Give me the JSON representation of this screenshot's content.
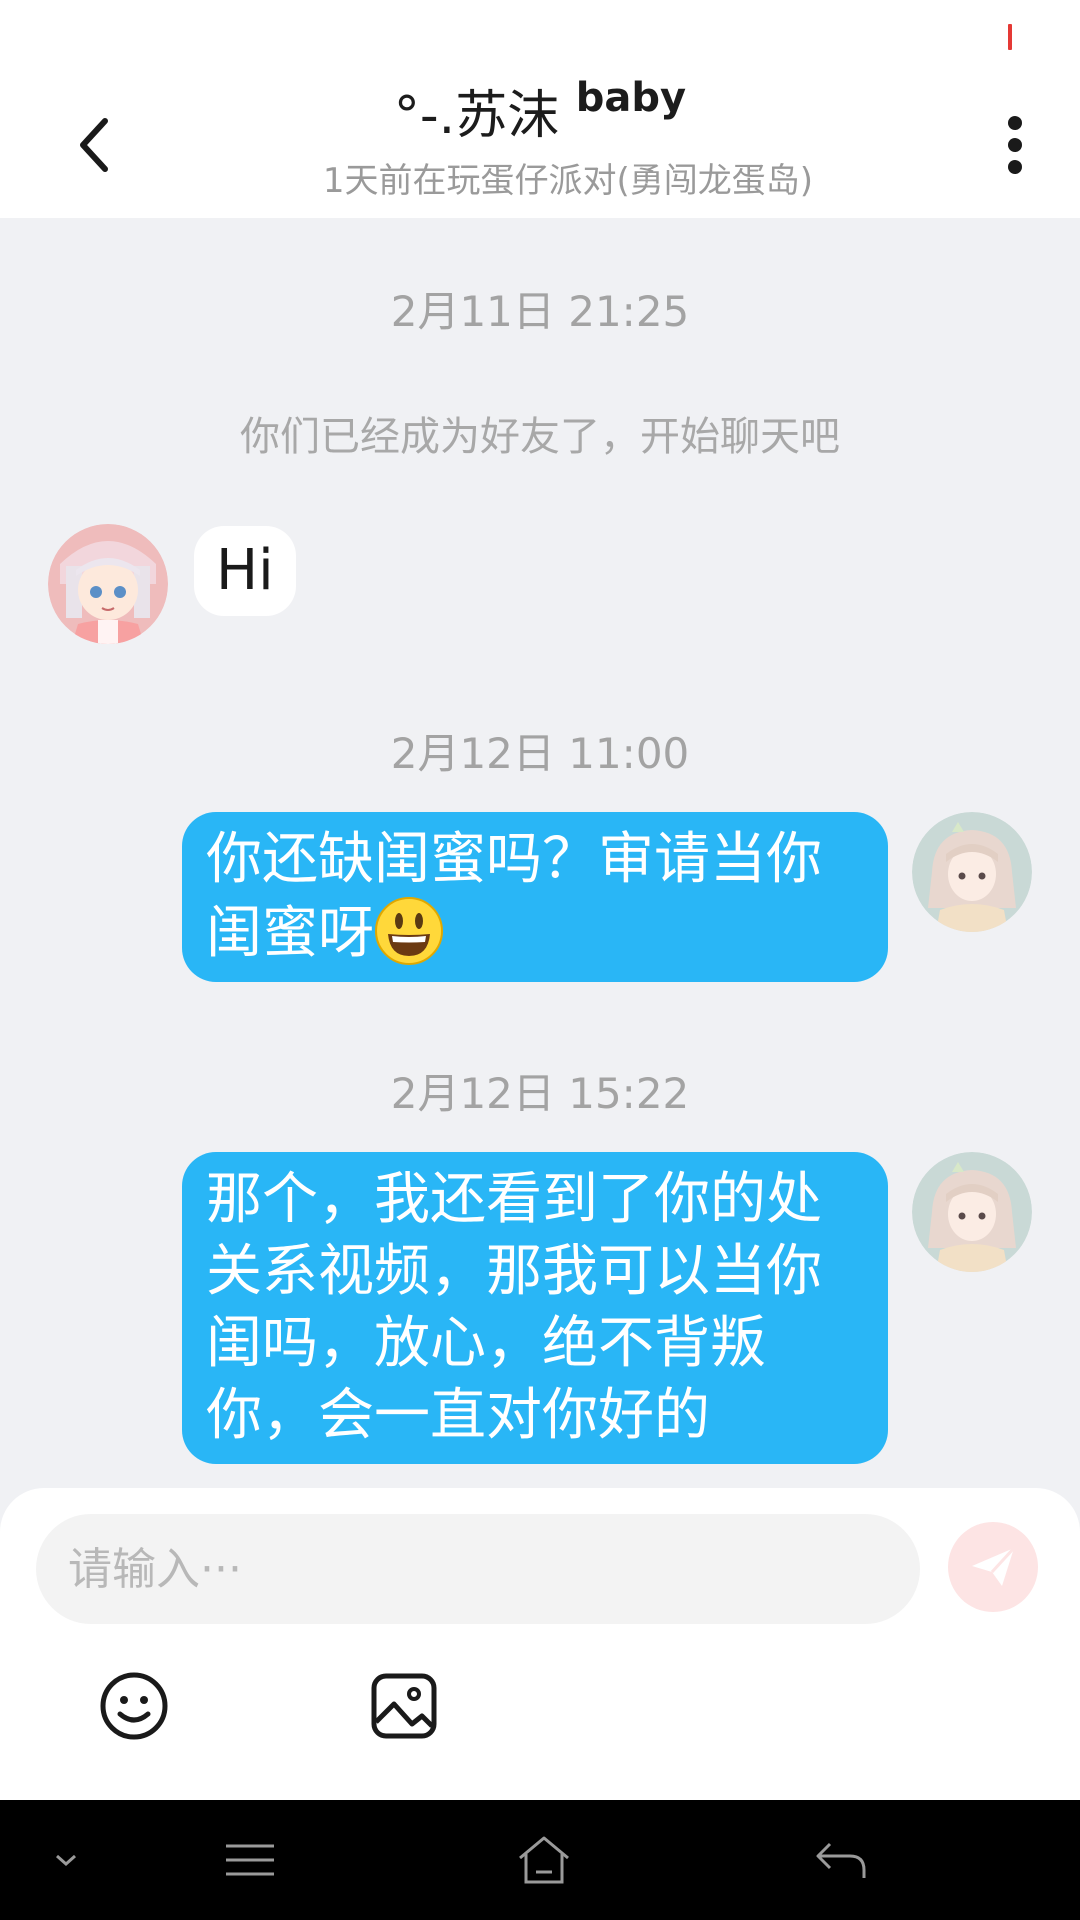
{
  "header": {
    "title": "°-.苏沫",
    "title_suffix": "baby",
    "subtitle": "1天前在玩蛋仔派对(勇闯龙蛋岛)"
  },
  "messages": {
    "ts1": "2月11日 21:25",
    "system": "你们已经成为好友了，开始聊天吧",
    "in1": "Hi",
    "ts2": "2月12日 11:00",
    "out1": "你还缺闺蜜吗？审请当你闺蜜呀",
    "ts3": "2月12日 15:22",
    "out2": "那个，我还看到了你的处关系视频，那我可以当你闺吗，放心，绝不背叛你，会一直对你好的"
  },
  "input": {
    "placeholder": "请输入···"
  },
  "icons": {
    "back": "chevron-left-icon",
    "more": "more-vertical-icon",
    "send": "send-icon",
    "emoji": "emoji-icon",
    "image": "image-icon",
    "nav_down": "chevron-down-icon",
    "nav_menu": "menu-icon",
    "nav_home": "home-icon",
    "nav_back": "back-arrow-icon"
  },
  "colors": {
    "outgoing_bubble": "#29b6f6",
    "incoming_bubble": "#ffffff",
    "chat_background": "#f0f1f4",
    "send_button": "#fde4e4"
  }
}
